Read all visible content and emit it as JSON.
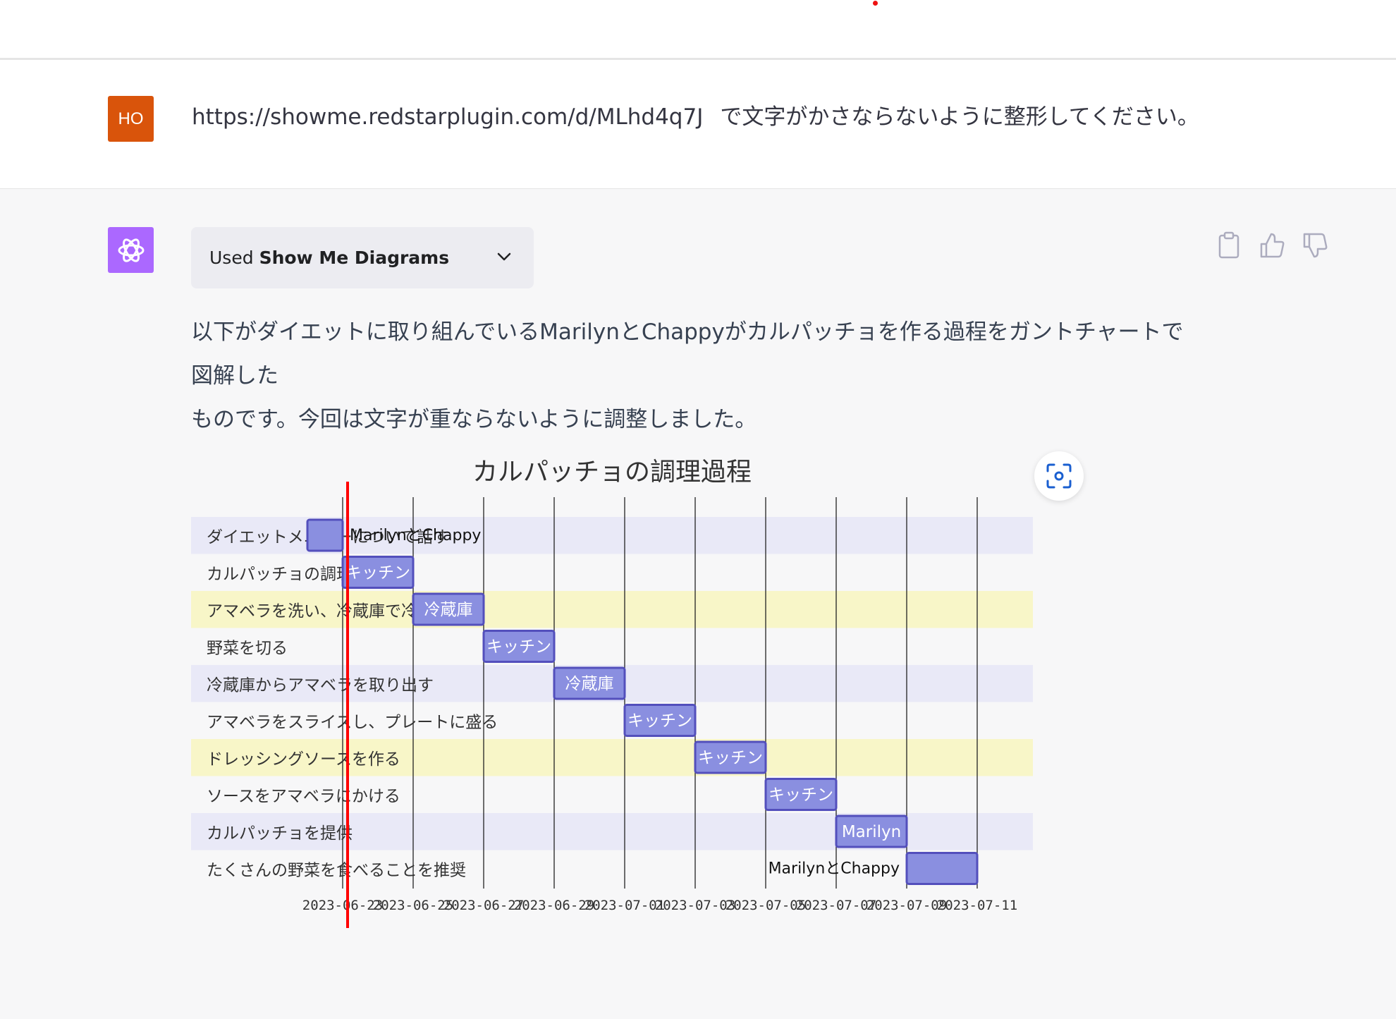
{
  "user_message": {
    "avatar": "HO",
    "url": "https://showme.redstarplugin.com/d/MLhd4q7J",
    "text": "で文字がかさならないように整形してください。"
  },
  "assistant": {
    "plugin_used": "Used",
    "plugin_name": "Show Me Diagrams",
    "reply_line1": "以下がダイエットに取り組んでいるMarilynとChappyがカルパッチョを作る過程をガントチャートで図解した",
    "reply_line2": "ものです。今回は文字が重ならないように調整しました。",
    "icons": [
      "clipboard-icon",
      "thumbs-up-icon",
      "thumbs-down-icon",
      "chevron-down-icon",
      "scan-icon",
      "openai-logo-icon"
    ]
  },
  "colors": {
    "user_avatar": "#d9540b",
    "assistant_avatar": "#ab68ff",
    "bar_fill": "#8a8fe0",
    "bar_stroke": "#534fbc",
    "today_line": "#ff0000",
    "row_lavender": "#e9e9f7",
    "row_yellow": "#f8f6c8",
    "row_white": "#f7f7f8"
  },
  "chart_data": {
    "type": "gantt",
    "title": "カルパッチョの調理過程",
    "tasks": [
      {
        "name": "ダイエットメニューについて話す",
        "start": "2023-06-22",
        "end": "2023-06-23",
        "label": "MarilynとChappy",
        "label_position": "outside-right"
      },
      {
        "name": "カルパッチョの調理を開始",
        "start": "2023-06-23",
        "end": "2023-06-25",
        "label": "キッチン",
        "label_position": "inside"
      },
      {
        "name": "アマベラを洗い、冷蔵庫で冷やす",
        "start": "2023-06-25",
        "end": "2023-06-27",
        "label": "冷蔵庫",
        "label_position": "inside"
      },
      {
        "name": "野菜を切る",
        "start": "2023-06-27",
        "end": "2023-06-29",
        "label": "キッチン",
        "label_position": "inside"
      },
      {
        "name": "冷蔵庫からアマベラを取り出す",
        "start": "2023-06-29",
        "end": "2023-07-01",
        "label": "冷蔵庫",
        "label_position": "inside"
      },
      {
        "name": "アマベラをスライスし、プレートに盛る",
        "start": "2023-07-01",
        "end": "2023-07-03",
        "label": "キッチン",
        "label_position": "inside"
      },
      {
        "name": "ドレッシングソースを作る",
        "start": "2023-07-03",
        "end": "2023-07-05",
        "label": "キッチン",
        "label_position": "inside"
      },
      {
        "name": "ソースをアマベラにかける",
        "start": "2023-07-05",
        "end": "2023-07-07",
        "label": "キッチン",
        "label_position": "inside"
      },
      {
        "name": "カルパッチョを提供",
        "start": "2023-07-07",
        "end": "2023-07-09",
        "label": "Marilyn",
        "label_position": "inside"
      },
      {
        "name": "たくさんの野菜を食べることを推奨",
        "start": "2023-07-09",
        "end": "2023-07-11",
        "label": "MarilynとChappy",
        "label_position": "outside-left"
      }
    ],
    "x_ticks": [
      "2023-06-23",
      "2023-06-25",
      "2023-06-27",
      "2023-06-29",
      "2023-07-01",
      "2023-07-03",
      "2023-07-05",
      "2023-07-07",
      "2023-07-09",
      "2023-07-11"
    ],
    "today": "2023-06-23",
    "row_colors": [
      "lavender",
      "white",
      "yellow",
      "white",
      "lavender",
      "white",
      "yellow",
      "white",
      "lavender",
      "white"
    ],
    "grid": true
  }
}
